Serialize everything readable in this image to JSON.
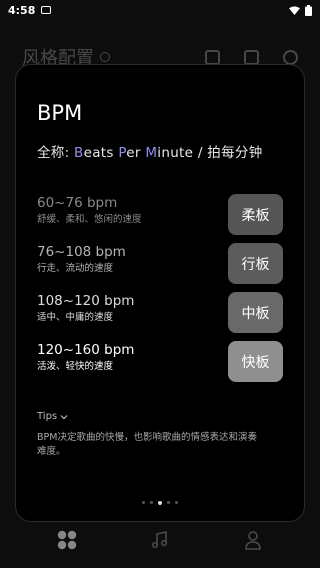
{
  "status_bar": {
    "time": "4:58"
  },
  "background": {
    "title": "风格配置"
  },
  "modal": {
    "title": "BPM",
    "subtitle": {
      "prefix": "全称: ",
      "b": "B",
      "b_rest": "eats ",
      "p": "P",
      "p_rest": "er ",
      "m": "M",
      "m_rest": "inute",
      "suffix": " / 拍每分钟"
    },
    "rows": [
      {
        "bpm": "60~76 bpm",
        "desc": "舒缓、柔和、悠闲的速度",
        "tempo": "柔板",
        "color": "#555555",
        "text_color": "#8a8a8a"
      },
      {
        "bpm": "76~108 bpm",
        "desc": "行走、流动的速度",
        "tempo": "行板",
        "color": "#5c5c5c",
        "text_color": "#b5b5b5"
      },
      {
        "bpm": "108~120 bpm",
        "desc": "适中、中庸的速度",
        "tempo": "中板",
        "color": "#696969",
        "text_color": "#dcdcdc"
      },
      {
        "bpm": "120~160 bpm",
        "desc": "活泼、轻快的速度",
        "tempo": "快板",
        "color": "#8f8f8f",
        "text_color": "#ffffff"
      }
    ],
    "tips_label": "Tips",
    "tips_text": "BPM决定歌曲的快慢，也影响歌曲的情感表达和演奏难度。",
    "page_indicator": {
      "total": 5,
      "active": 3
    }
  },
  "colors": {
    "accent": "#8f8ff0",
    "card_bg": "#000000",
    "page_bg": "#0d0d0d"
  }
}
